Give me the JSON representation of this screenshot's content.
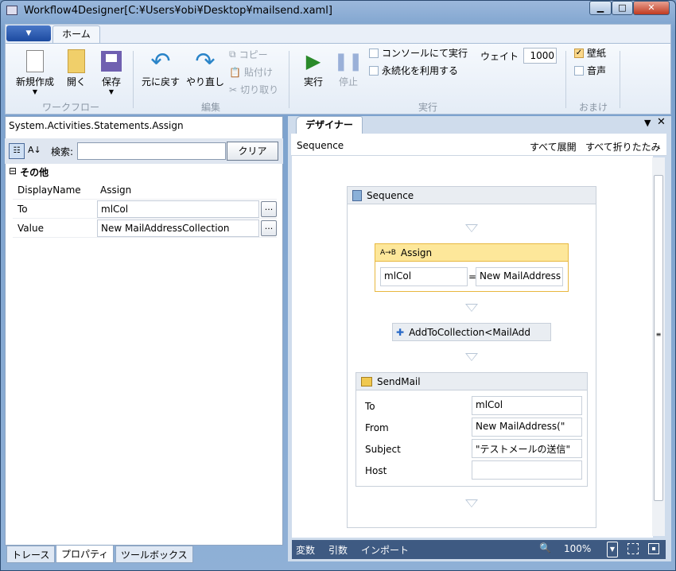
{
  "window": {
    "title": "Workflow4Designer[C:¥Users¥obi¥Desktop¥mailsend.xaml]",
    "min": "▁",
    "max": "□",
    "close": "✕"
  },
  "ribbon": {
    "app_menu": "▼",
    "tab": "ホーム",
    "workflow": {
      "group": "ワークフロー",
      "new": "新規作成",
      "open": "開く",
      "save": "保存"
    },
    "edit": {
      "group": "編集",
      "undo": "元に戻す",
      "redo": "やり直し",
      "copy": "コピー",
      "paste": "貼付け",
      "cut": "切り取り"
    },
    "run": {
      "group": "実行",
      "run": "実行",
      "stop": "停止",
      "console": "コンソールにて実行",
      "console_checked": false,
      "persist": "永続化を利用する",
      "persist_checked": false,
      "wait_label": "ウェイト",
      "wait_value": "1000"
    },
    "extra": {
      "group": "おまけ",
      "wallpaper": "壁紙",
      "wallpaper_checked": true,
      "sound": "音声",
      "sound_checked": false
    }
  },
  "properties": {
    "type": "System.Activities.Statements.Assign",
    "search_label": "検索:",
    "search_value": "",
    "clear": "クリア",
    "category": "その他",
    "rows": [
      {
        "key": "DisplayName",
        "value": "Assign"
      },
      {
        "key": "To",
        "value": "mlCol"
      },
      {
        "key": "Value",
        "value": "New MailAddressCollection"
      }
    ],
    "ellipsis": "..."
  },
  "bottom_tabs": [
    "トレース",
    "プロパティ",
    "ツールボックス"
  ],
  "designer": {
    "tab": "デザイナー",
    "breadcrumb": "Sequence",
    "expand_all": "すべて展開",
    "collapse_all": "すべて折りたたみ",
    "sequence": "Sequence",
    "assign": {
      "title": "Assign",
      "to": "mlCol",
      "eq": "=",
      "value": "New MailAddress"
    },
    "add": "AddToCollection<MailAdd",
    "sendmail": {
      "title": "SendMail",
      "fields": [
        {
          "k": "To",
          "v": "mlCol"
        },
        {
          "k": "From",
          "v": "New MailAddress(\""
        },
        {
          "k": "Subject",
          "v": "\"テストメールの送信\""
        },
        {
          "k": "Host",
          "v": ""
        }
      ]
    },
    "footer": {
      "variables": "変数",
      "arguments": "引数",
      "imports": "インポート",
      "zoom": "100%"
    }
  },
  "colors": {
    "accent": "#3e5a82",
    "assign_header": "#fde79a",
    "run_green": "#2a8a2a"
  }
}
